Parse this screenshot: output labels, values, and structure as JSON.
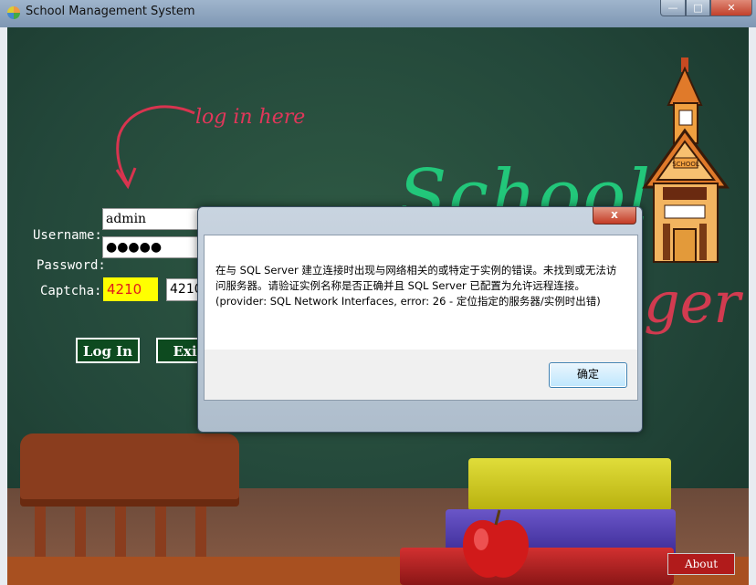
{
  "window": {
    "title": "School Management System",
    "min_glyph": "—",
    "max_glyph": "□",
    "close_glyph": "✕"
  },
  "board": {
    "hint": "log in here",
    "school_word": "School",
    "manager_word": "ager",
    "schoolhouse_sign": "SCHOOL"
  },
  "form": {
    "username_label": "Username:",
    "username_value": "admin",
    "password_label": "Password:",
    "password_value": "●●●●●",
    "captcha_label": "Captcha:",
    "captcha_code": "4210",
    "captcha_input": "4210",
    "login_button": "Log In",
    "exit_button": "Exit"
  },
  "about_button": "About",
  "dialog": {
    "close_glyph": "x",
    "message": "在与 SQL Server 建立连接时出现与网络相关的或特定于实例的错误。未找到或无法访问服务器。请验证实例名称是否正确并且 SQL Server 已配置为允许远程连接。 (provider: SQL Network Interfaces, error: 26 - 定位指定的服务器/实例时出错)",
    "ok_button": "确定"
  },
  "colors": {
    "chalkboard": "#23473a",
    "school_word": "#22c77a",
    "manager_word": "#d23b50",
    "captcha_bg": "#ffff00",
    "captcha_text": "#e01b1b",
    "login_button_bg": "#0d4a1f",
    "about_bg": "#b11b1b"
  }
}
